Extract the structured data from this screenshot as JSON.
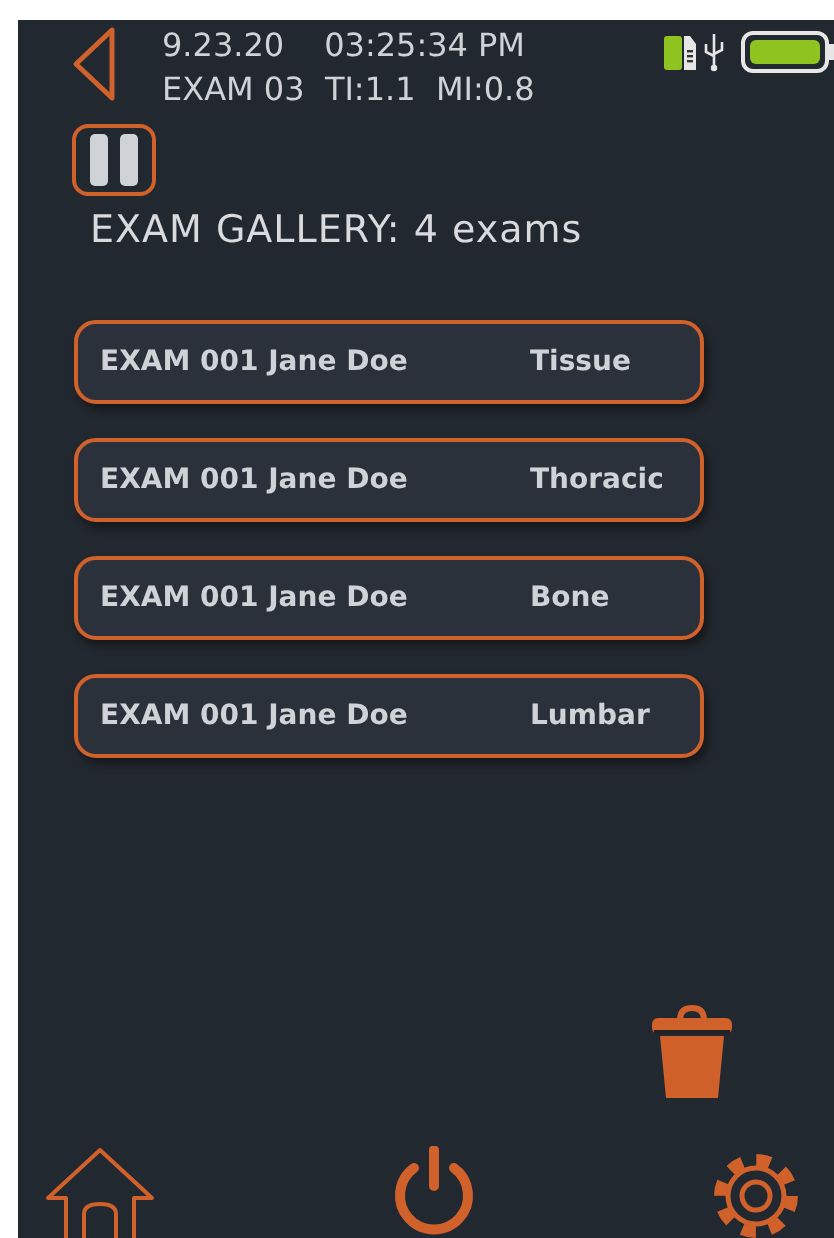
{
  "header": {
    "date": "9.23.20",
    "time": "03:25:34 PM",
    "exam_info": "EXAM 03  TI:1.1  MI:0.8"
  },
  "gallery": {
    "title": "EXAM GALLERY: 4 exams",
    "exams": [
      {
        "name": "EXAM 001 Jane Doe",
        "type": "Tissue"
      },
      {
        "name": "EXAM 001 Jane Doe",
        "type": "Thoracic"
      },
      {
        "name": "EXAM 001 Jane Doe",
        "type": "Bone"
      },
      {
        "name": "EXAM 001 Jane Doe",
        "type": "Lumbar"
      }
    ]
  }
}
